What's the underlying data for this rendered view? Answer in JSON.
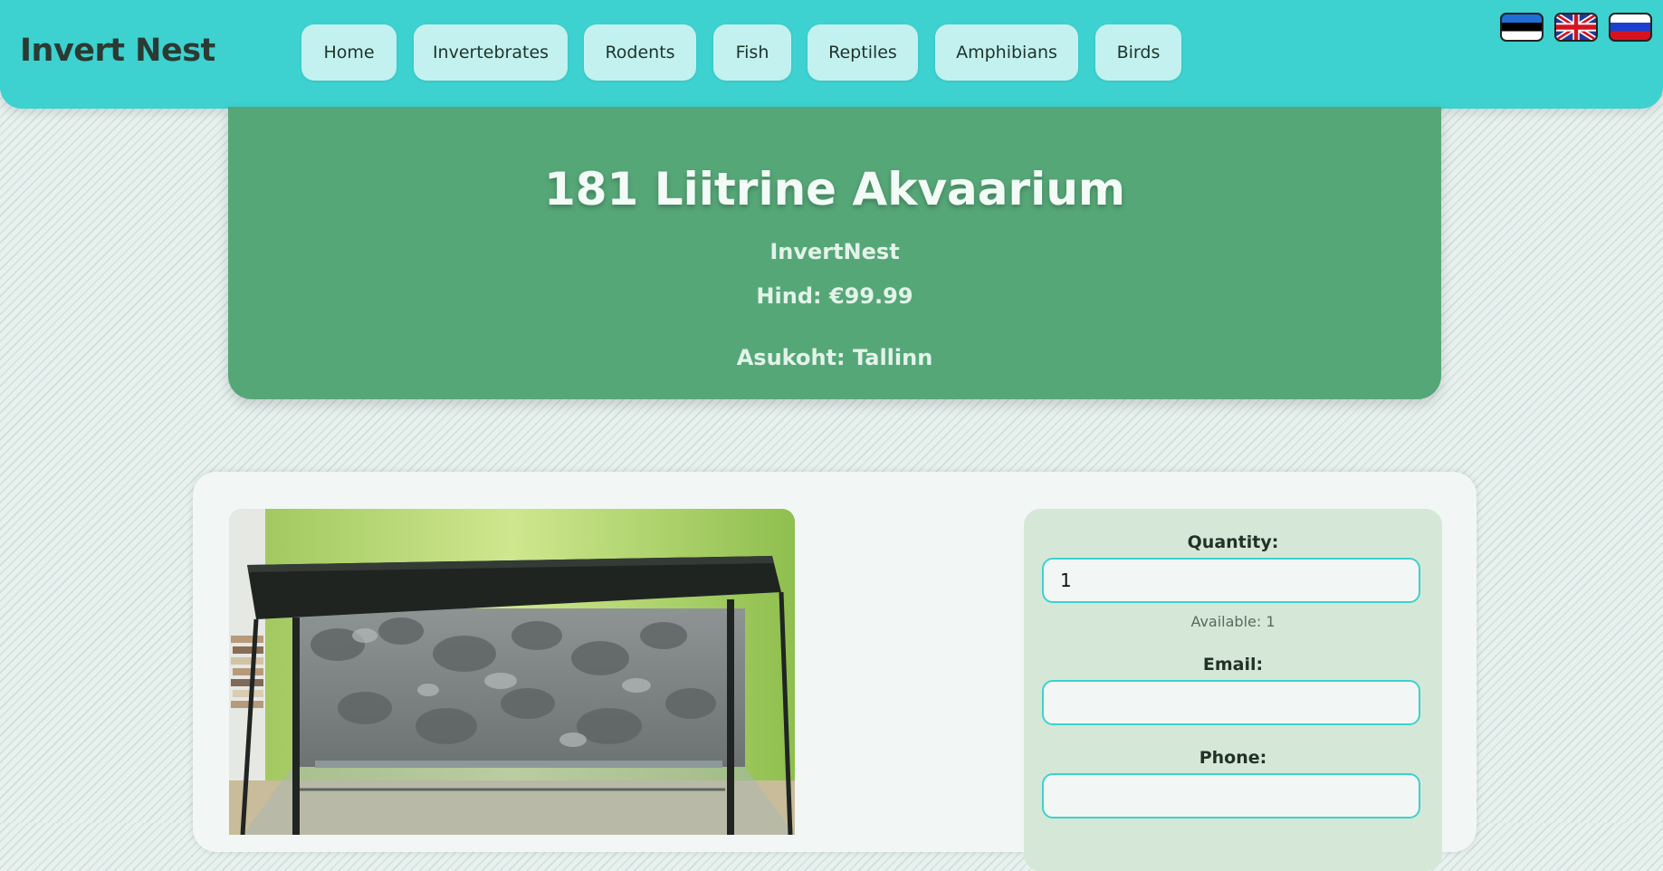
{
  "header": {
    "logo": "Invert Nest",
    "nav": [
      "Home",
      "Invertebrates",
      "Rodents",
      "Fish",
      "Reptiles",
      "Amphibians",
      "Birds"
    ],
    "languages": [
      "estonian-flag-icon",
      "uk-flag-icon",
      "russian-flag-icon"
    ]
  },
  "product": {
    "title": "181 Liitrine Akvaarium",
    "seller": "InvertNest",
    "price": "Hind: €99.99",
    "location": "Asukoht: Tallinn"
  },
  "form": {
    "quantity_label": "Quantity:",
    "quantity_value": "1",
    "available": "Available: 1",
    "email_label": "Email:",
    "email_value": "",
    "phone_label": "Phone:",
    "phone_value": ""
  },
  "colors": {
    "header": "#3dd1cf",
    "title_card": "#56a778",
    "nav_button": "#c3f1ef",
    "form_panel": "#d5e8d8",
    "input_border": "#3dd1cf"
  }
}
